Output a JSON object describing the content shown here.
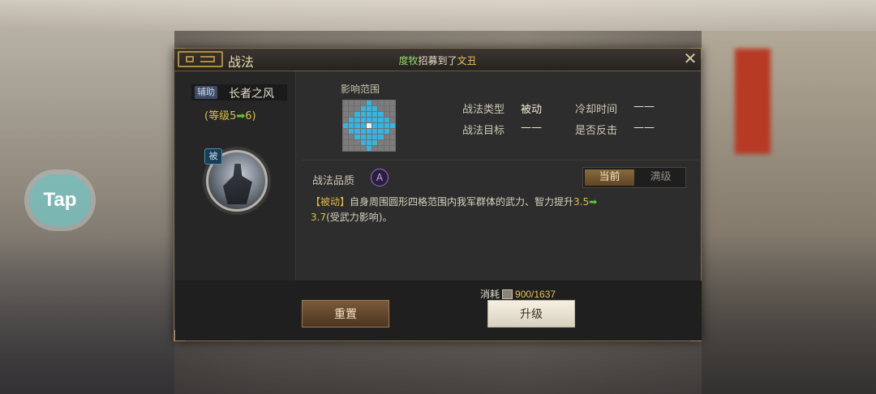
{
  "background": {
    "tap_button_label": "Tap"
  },
  "dialog": {
    "title": "战法",
    "notice": {
      "player": "度牧",
      "middle": "招募到了",
      "target": "文丑"
    },
    "close_icon": "close-icon"
  },
  "tactic": {
    "type_tag": "辅助",
    "name": "长者之风",
    "level_prefix": "(等级5",
    "level_arrow": "➡",
    "level_suffix": "6)",
    "portrait_badge": "被"
  },
  "range": {
    "label": "影响范围",
    "grid_size": 9,
    "shape": "diamond radius 4"
  },
  "info": {
    "type_label": "战法类型",
    "type_value": "被动",
    "cooldown_label": "冷却时间",
    "cooldown_value": "——",
    "target_label": "战法目标",
    "target_value": "——",
    "counter_label": "是否反击",
    "counter_value": "——"
  },
  "quality": {
    "label": "战法品质",
    "badge": "A"
  },
  "toggle": {
    "current": "当前",
    "full": "满级",
    "selected": "current"
  },
  "description": {
    "tag": "【被动】",
    "text": "自身周围圆形四格范围内我军群体的武力、智力提升",
    "value_from": "3.5",
    "arrow": "➡",
    "value_to": "3.7",
    "suffix": "(受武力影响)。"
  },
  "footer": {
    "cost_label": "消耗",
    "cost_value": "900/1637",
    "reset_label": "重置",
    "upgrade_label": "升级"
  },
  "colors": {
    "accent_gold": "#e9c05b",
    "arrow_green": "#67c43b",
    "range_cell": "#36b5e0",
    "quality_purple": "#9b6fd6"
  }
}
